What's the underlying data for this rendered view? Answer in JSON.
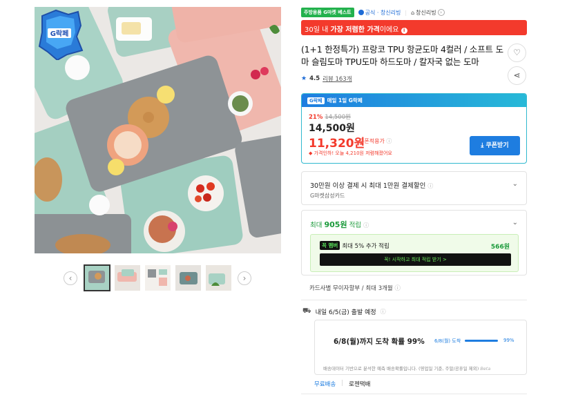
{
  "product": {
    "tags": {
      "best": "주방용품 G마켓 베스트",
      "official": "공식 · 창신리빙",
      "shop": "창신리빙"
    },
    "banner": {
      "prefix": "30일 내 ",
      "strong": "가장 저렴한 가격",
      "suffix": "이에요"
    },
    "title": "(1+1 한정특가) 프랑코 TPU 항균도마 4컬러 / 소프트 도마 슬림도마 TPU도마 하드도마 / 칼자국 없는 도마",
    "rating": {
      "score": "4.5",
      "reviews": "리뷰 163개"
    },
    "price_box": {
      "header_logo": "G락페",
      "header": "매일 1일 G락페",
      "discount_percent": "21%",
      "original_price": "14,500원",
      "price": "14,500원",
      "coupon_price": "11,320원",
      "coupon_applied": "쿠폰적용가",
      "lowest_note": "가격인하! 오늘 4,210원 저렴해졌어요",
      "coupon_button": "쿠폰받기"
    },
    "card_benefit": {
      "line1": "30만원 이상 결제 시 최대 1만원 결제할인",
      "line2": "G마켓삼성카드"
    },
    "points": {
      "prefix": "최대 ",
      "amount": "905원",
      "suffix": " 적립",
      "member_badge": "꼭 멤버",
      "member_text": "최대 5% 추가 적립",
      "member_amount": "566원",
      "cta": "꼭! 시작하고 최대 적립 받기 >"
    },
    "installment": "카드사별 무이자할부 / 최대 3개월",
    "shipping": {
      "departure": "내일 6/5(금) 출발 예정",
      "probability": "6/8(월)까지 도착 확률 99%",
      "chart_label": "6/8(월) 도착",
      "chart_value": 99,
      "chart_pct": "99%",
      "note": "배송데이터 기반으로 분석한 예측 배송확률입니다. (영업일 기준, 주말/공휴일 제외)",
      "beta": "Beta",
      "free": "무료배송",
      "carrier": "로젠택배"
    }
  },
  "colors": {
    "accent_blue": "#1e7de0",
    "sale_red": "#f33a2c",
    "green": "#1a9a3a"
  },
  "icons": [
    "heart-icon",
    "share-icon",
    "star-icon",
    "truck-icon",
    "chevron-down-icon",
    "info-icon",
    "download-icon",
    "chevron-left-icon",
    "chevron-right-icon"
  ]
}
